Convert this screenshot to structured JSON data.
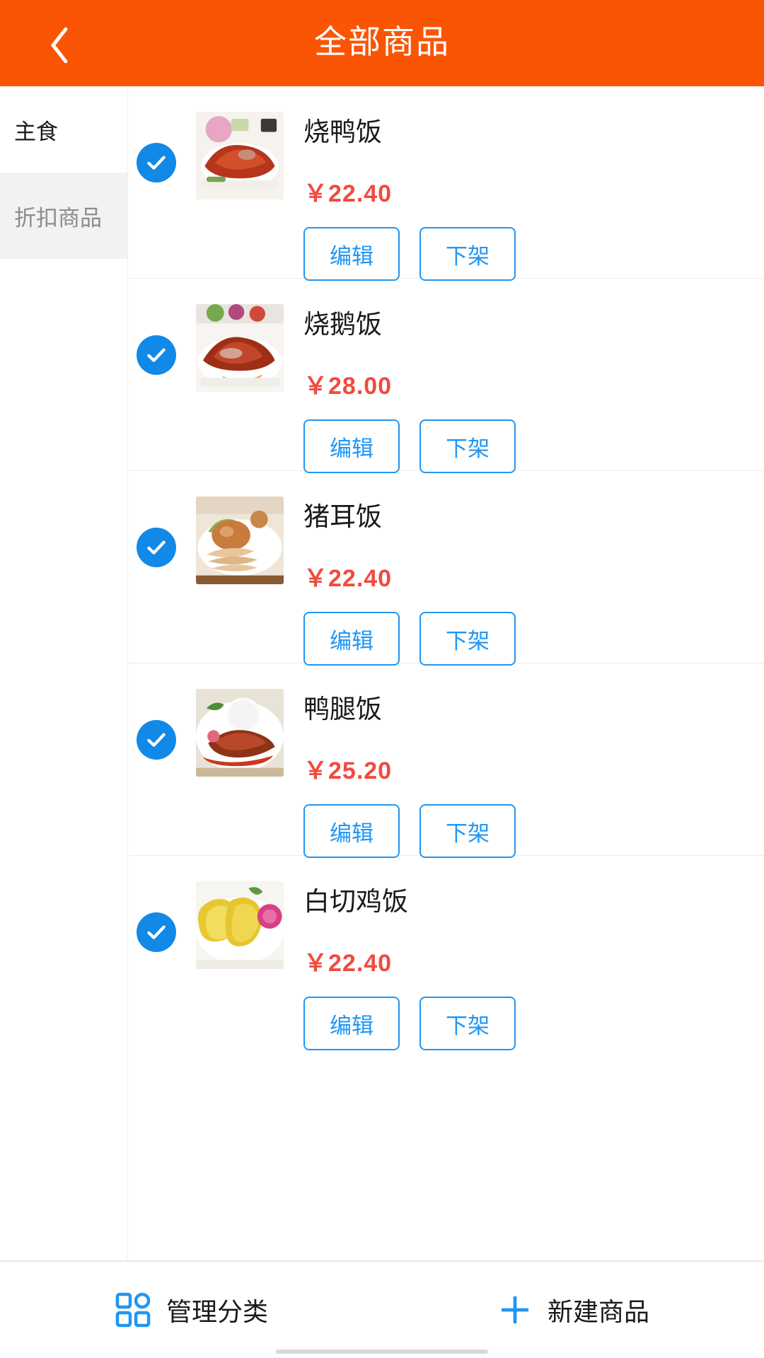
{
  "header": {
    "title": "全部商品",
    "back_icon": "chevron-left-icon",
    "bg_color": "#FA5505",
    "text_color": "#FFFFFF"
  },
  "sidebar": {
    "items": [
      {
        "label": "主食",
        "active": true
      },
      {
        "label": "折扣商品",
        "active": false
      }
    ]
  },
  "list": {
    "check_icon": "check-circle-icon",
    "check_color": "#1289E6",
    "price_color": "#F04B3F",
    "button_color": "#2196F3",
    "items": [
      {
        "name": "烧鸭饭",
        "price": "￥22.40",
        "selected": true,
        "image_alt": "roast-duck-rice-photo",
        "edit_label": "编辑",
        "unlist_label": "下架"
      },
      {
        "name": "烧鹅饭",
        "price": "￥28.00",
        "selected": true,
        "image_alt": "roast-goose-rice-photo",
        "edit_label": "编辑",
        "unlist_label": "下架"
      },
      {
        "name": "猪耳饭",
        "price": "￥22.40",
        "selected": true,
        "image_alt": "pig-ear-rice-photo",
        "edit_label": "编辑",
        "unlist_label": "下架"
      },
      {
        "name": "鸭腿饭",
        "price": "￥25.20",
        "selected": true,
        "image_alt": "duck-leg-rice-photo",
        "edit_label": "编辑",
        "unlist_label": "下架"
      },
      {
        "name": "白切鸡饭",
        "price": "￥22.40",
        "selected": true,
        "image_alt": "white-cut-chicken-rice-photo",
        "edit_label": "编辑",
        "unlist_label": "下架"
      }
    ]
  },
  "bottombar": {
    "manage": {
      "label": "管理分类",
      "icon": "grid-icon"
    },
    "create": {
      "label": "新建商品",
      "icon": "plus-icon"
    }
  }
}
